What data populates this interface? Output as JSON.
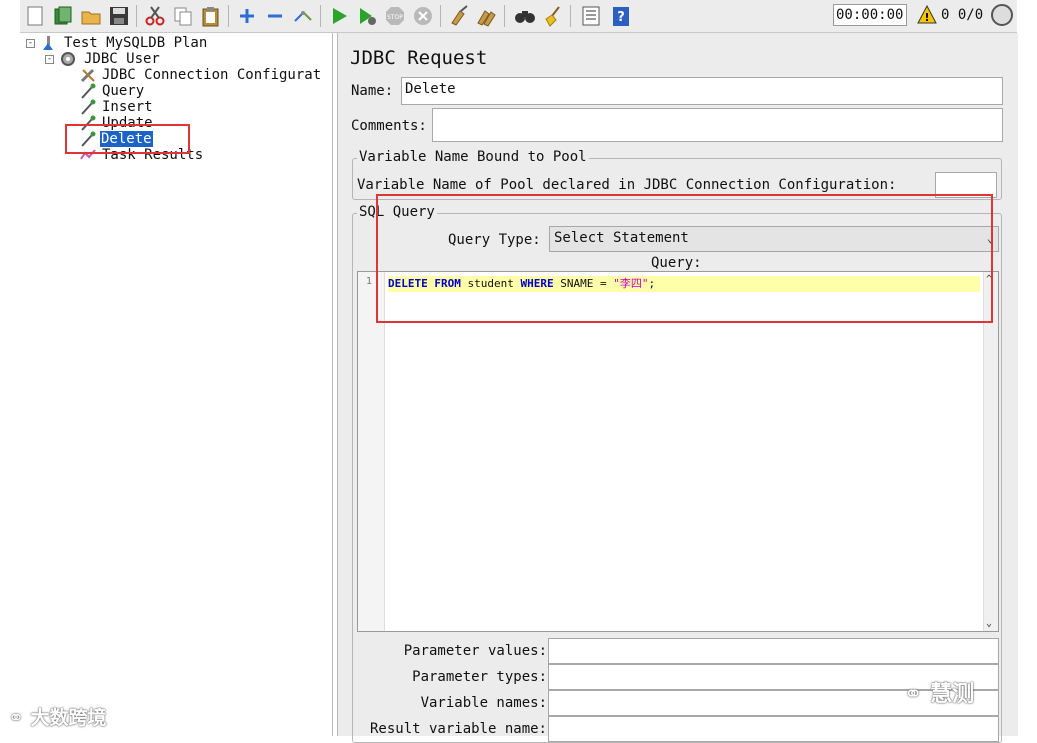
{
  "toolbar": {
    "icons": [
      "new-icon",
      "templates-icon",
      "open-icon",
      "save-icon",
      "cut-icon",
      "copy-icon",
      "paste-icon",
      "expand-icon",
      "collapse-icon",
      "toggle-icon",
      "start-icon",
      "start-no-pause-icon",
      "stop-icon",
      "shutdown-icon",
      "clear-icon",
      "clear-all-icon",
      "search-icon",
      "reset-search-icon",
      "function-helper-icon",
      "help-icon"
    ],
    "timer": "00:00:00",
    "warning_count": "0",
    "threads": "0/0"
  },
  "tree": {
    "items": [
      {
        "label": "Test MySQLDB Plan"
      },
      {
        "label": "JDBC User"
      },
      {
        "label": "JDBC Connection Configurat"
      },
      {
        "label": "Query"
      },
      {
        "label": "Insert"
      },
      {
        "label": "Update"
      },
      {
        "label": "Delete"
      },
      {
        "label": "Task Results"
      }
    ]
  },
  "panel": {
    "title": "JDBC Request",
    "name_label": "Name:",
    "name_value": "Delete",
    "comments_label": "Comments:",
    "comments_value": "",
    "pool_group_title": "Variable Name Bound to Pool",
    "pool_label": "Variable Name of Pool declared in JDBC Connection Configuration:",
    "pool_value": "",
    "sql_group_title": "SQL Query",
    "query_type_label": "Query Type:",
    "query_type_value": "Select Statement",
    "query_label": "Query:",
    "line_number": "1",
    "code": {
      "kw1": "DELETE FROM",
      "t1": " student ",
      "kw2": "WHERE",
      "t2": " SNAME  = ",
      "str": "\"李四\"",
      "end": ";"
    },
    "param_values_label": "Parameter values:",
    "param_types_label": "Parameter types:",
    "var_names_label": "Variable names:",
    "result_var_label": "Result variable name:"
  },
  "watermarks": {
    "left": "大数跨境",
    "right": "慧测"
  },
  "colors": {
    "highlight_red": "#e03535",
    "selection_blue": "#1c63c7",
    "keyword_blue": "#0000c8",
    "string_magenta": "#c800c8",
    "line_highlight": "#ffffaa"
  }
}
